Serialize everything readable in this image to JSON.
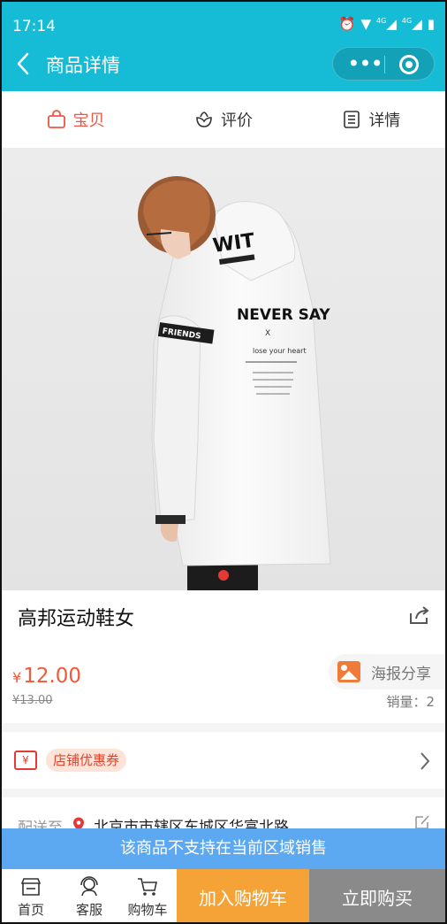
{
  "status_bar": {
    "time": "17:14",
    "network": "4G"
  },
  "header": {
    "title": "商品详情"
  },
  "tabs": [
    {
      "label": "宝贝",
      "active": true,
      "icon": "bag-icon"
    },
    {
      "label": "评价",
      "active": false,
      "icon": "flower-icon"
    },
    {
      "label": "详情",
      "active": false,
      "icon": "document-icon"
    }
  ],
  "hero": {
    "print_top": "WIT",
    "print_main": "NEVER SAY",
    "print_x": "X",
    "print_line1": "lose your heart",
    "sleeve_text": "FRIENDS"
  },
  "product": {
    "title": "高邦运动鞋女",
    "currency": "¥",
    "price": "12.00",
    "old_price": "¥13.00",
    "poster_label": "海报分享",
    "sales": "销量：2"
  },
  "coupon": {
    "icon_text": "¥",
    "label": "店铺优惠券"
  },
  "delivery": {
    "label": "配送至",
    "address": "北京市市辖区东城区华富北路"
  },
  "banner": {
    "text": "该商品不支持在当前区域销售"
  },
  "bottom_nav": {
    "home": "首页",
    "service": "客服",
    "cart": "购物车",
    "add_to_cart": "加入购物车",
    "buy_now": "立即购买"
  },
  "colors": {
    "brand": "#16bcd6",
    "accent_red": "#ef5544",
    "cart_orange": "#f5a236",
    "buy_gray": "#8a8a8a",
    "banner_blue": "#5ca9f2"
  }
}
